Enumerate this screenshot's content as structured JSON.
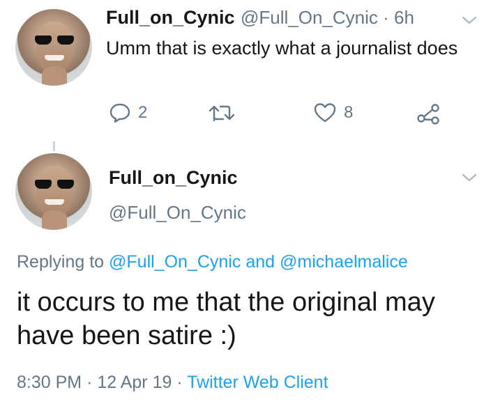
{
  "tweet1": {
    "name": "Full_on_Cynic",
    "handle": "@Full_On_Cynic",
    "separator": "·",
    "time": "6h",
    "text": "Umm that is exactly what a journalist does",
    "reply_count": "2",
    "retweet_count": "",
    "like_count": "8"
  },
  "tweet2": {
    "name": "Full_on_Cynic",
    "handle": "@Full_On_Cynic",
    "replying_prefix": "Replying to",
    "reply_mention1": "@Full_On_Cynic",
    "reply_and": "and",
    "reply_mention2": "@michaelmalice",
    "text": "it occurs to me that the original may have been satire :)",
    "time": "8:30 PM",
    "sep1": "·",
    "date": "12 Apr 19",
    "sep2": "·",
    "client": "Twitter Web Client"
  },
  "colors": {
    "accent": "#1da1f2",
    "secondary_text": "#657786",
    "primary_text": "#14171a"
  }
}
